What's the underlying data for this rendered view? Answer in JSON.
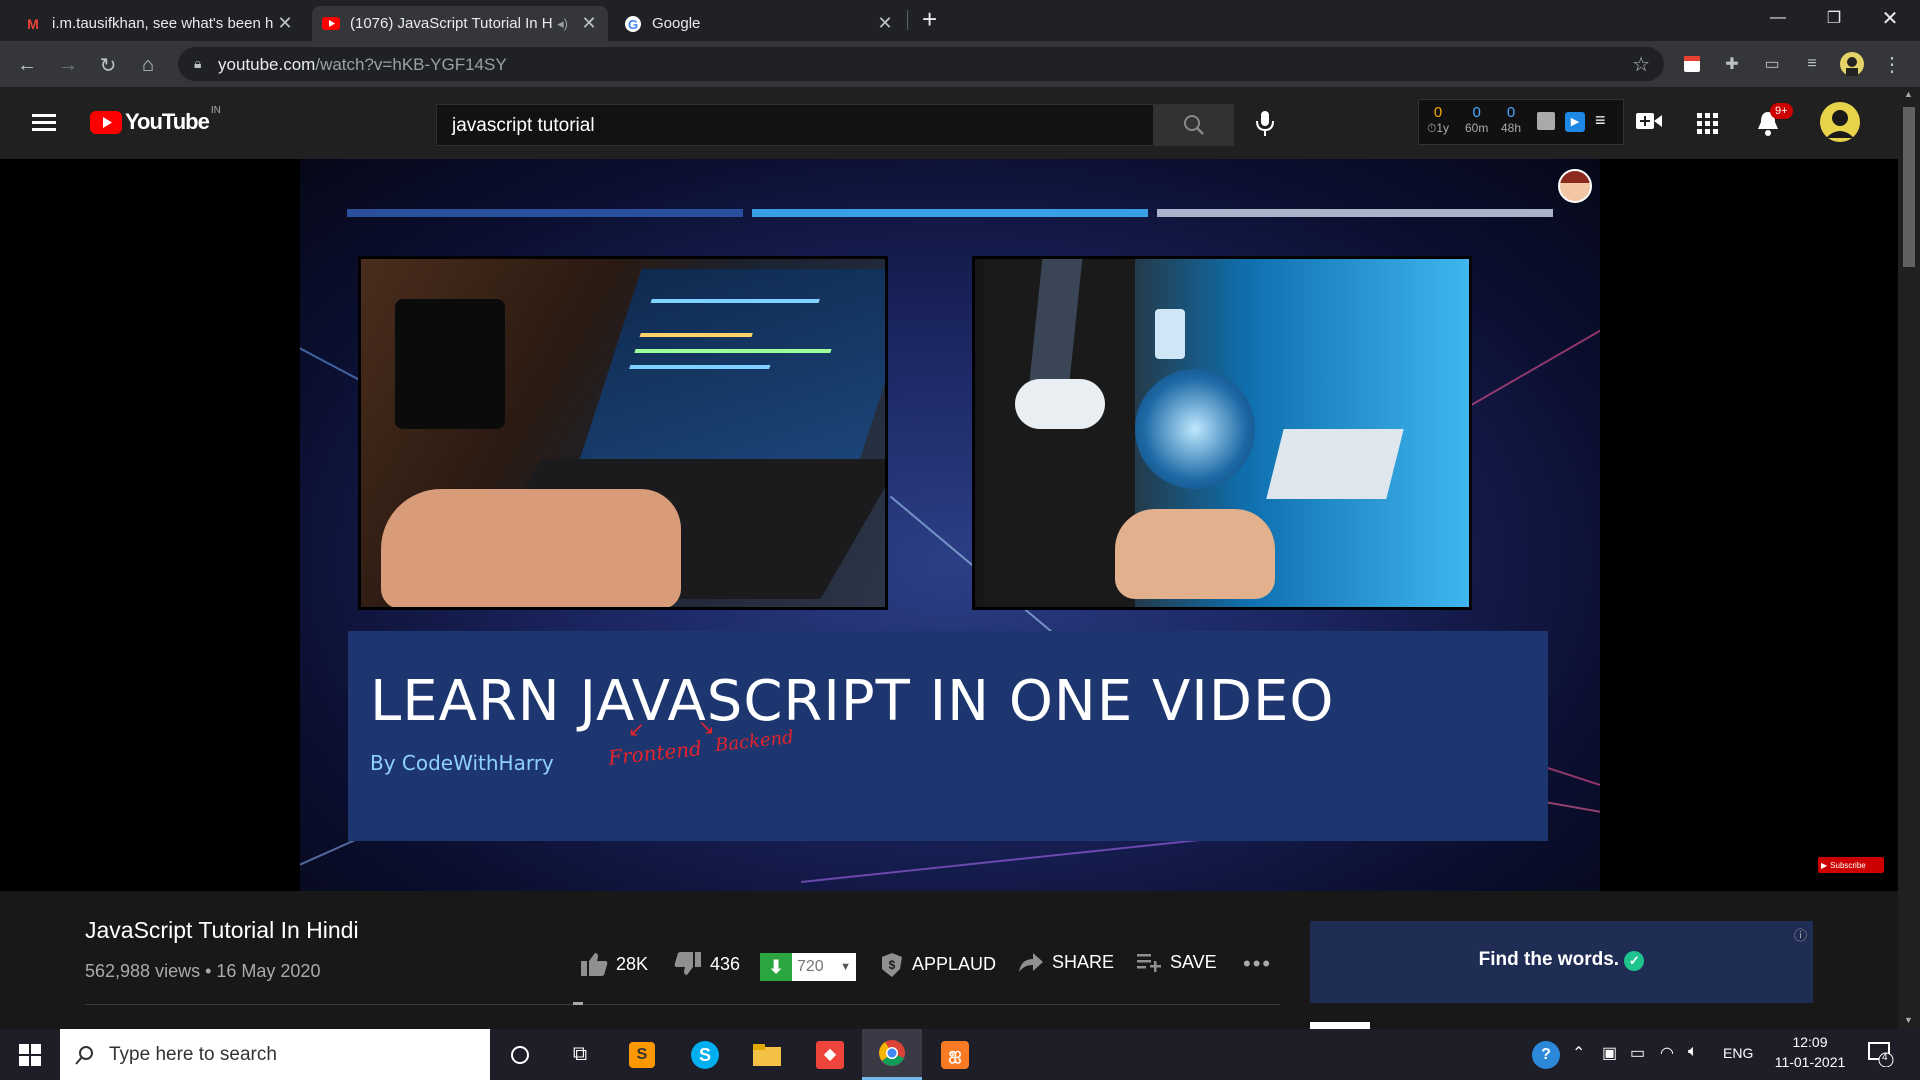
{
  "browser": {
    "tabs": [
      {
        "title": "i.m.tausifkhan, see what's been h",
        "favicon": "gmail-icon",
        "active": false
      },
      {
        "title": "(1076) JavaScript Tutorial In H",
        "favicon": "youtube-icon",
        "active": true
      },
      {
        "title": "Google",
        "favicon": "google-icon",
        "active": false
      }
    ],
    "url_host": "youtube.com",
    "url_path": "/watch?v=hKB-YGF14SY"
  },
  "youtube": {
    "logo_text": "YouTube",
    "region": "IN",
    "search_value": "javascript tutorial",
    "notifications_badge": "9+",
    "stats": [
      {
        "value": "0",
        "label": "1y"
      },
      {
        "value": "0",
        "label": "60m"
      },
      {
        "value": "0",
        "label": "48h"
      }
    ]
  },
  "video": {
    "thumbnail_title": "LEARN JAVASCRIPT IN ONE VIDEO",
    "thumbnail_byline": "By CodeWithHarry",
    "annotation_frontend": "Frontend",
    "annotation_backend": "Backend",
    "subscribe_badge": "Subscribe",
    "title": "JavaScript Tutorial In Hindi",
    "meta": "562,988 views • 16 May 2020",
    "likes": "28K",
    "dislikes": "436",
    "quality": "720",
    "applaud_label": "APPLAUD",
    "share_label": "SHARE",
    "save_label": "SAVE"
  },
  "ad": {
    "text": "Find the words."
  },
  "taskbar": {
    "search_placeholder": "Type here to search",
    "lang": "ENG",
    "time": "12:09",
    "date": "11-01-2021",
    "notif_count": "4"
  },
  "colors": {
    "youtube_red": "#ff0000",
    "banner": "#1d3670",
    "accent_green": "#2ba640"
  }
}
